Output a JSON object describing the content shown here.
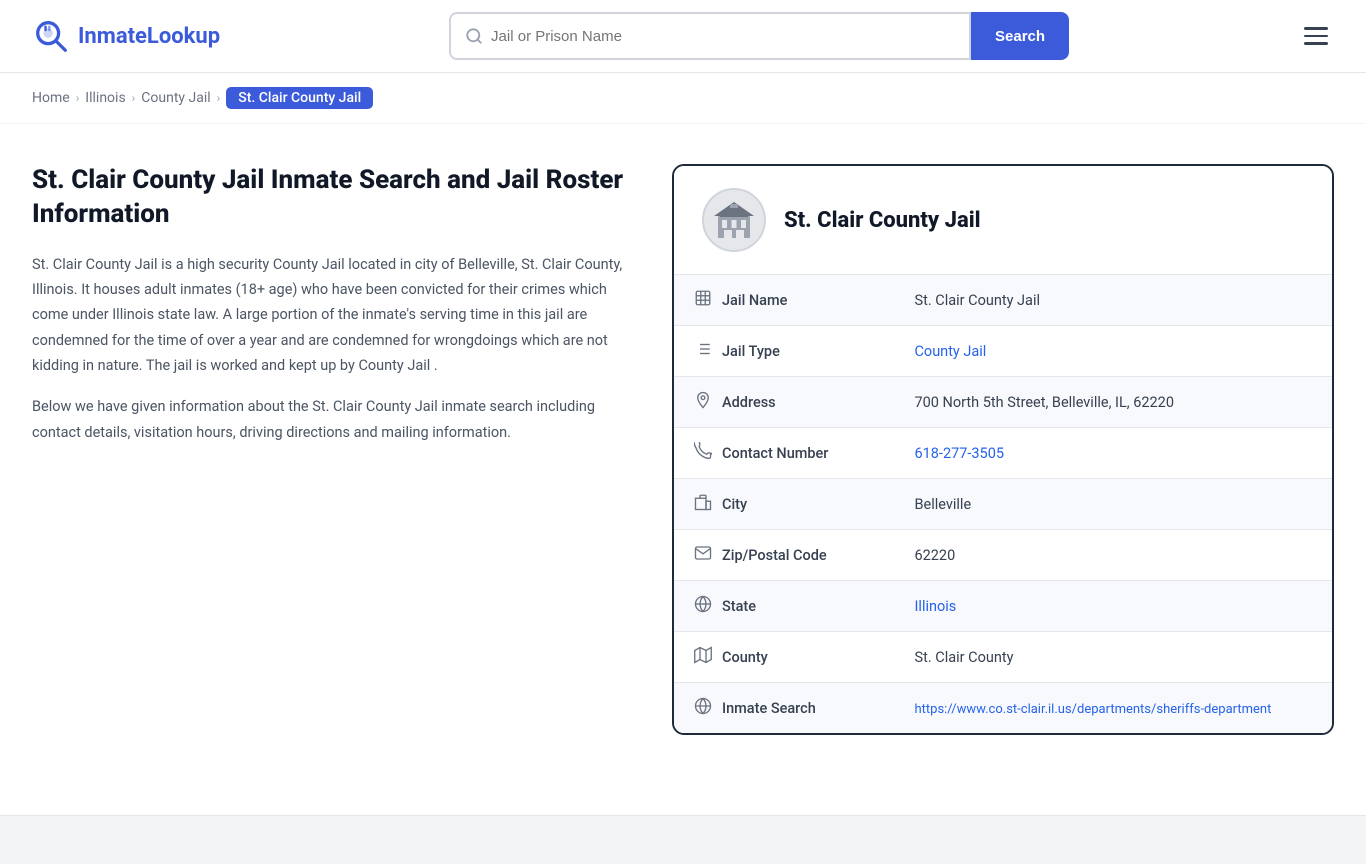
{
  "site": {
    "name": "InmateLookup",
    "name_part1": "Inmate",
    "name_part2": "Lookup"
  },
  "header": {
    "search_placeholder": "Jail or Prison Name",
    "search_button": "Search",
    "hamburger_label": "Menu"
  },
  "breadcrumb": {
    "home": "Home",
    "illinois": "Illinois",
    "county_jail": "County Jail",
    "current": "St. Clair County Jail"
  },
  "left": {
    "heading": "St. Clair County Jail Inmate Search and Jail Roster Information",
    "paragraph1": "St. Clair County Jail is a high security County Jail located in city of Belleville, St. Clair County, Illinois. It houses adult inmates (18+ age) who have been convicted for their crimes which come under Illinois state law. A large portion of the inmate's serving time in this jail are condemned for the time of over a year and are condemned for wrongdoings which are not kidding in nature. The jail is worked and kept up by County Jail .",
    "paragraph2": "Below we have given information about the St. Clair County Jail inmate search including contact details, visitation hours, driving directions and mailing information."
  },
  "card": {
    "title": "St. Clair County Jail",
    "rows": [
      {
        "label": "Jail Name",
        "value": "St. Clair County Jail",
        "link": false,
        "icon": "jail-icon"
      },
      {
        "label": "Jail Type",
        "value": "County Jail",
        "link": true,
        "icon": "list-icon"
      },
      {
        "label": "Address",
        "value": "700 North 5th Street, Belleville, IL, 62220",
        "link": false,
        "icon": "location-icon"
      },
      {
        "label": "Contact Number",
        "value": "618-277-3505",
        "link": true,
        "icon": "phone-icon"
      },
      {
        "label": "City",
        "value": "Belleville",
        "link": false,
        "icon": "city-icon"
      },
      {
        "label": "Zip/Postal Code",
        "value": "62220",
        "link": false,
        "icon": "mail-icon"
      },
      {
        "label": "State",
        "value": "Illinois",
        "link": true,
        "icon": "globe-icon"
      },
      {
        "label": "County",
        "value": "St. Clair County",
        "link": false,
        "icon": "county-icon"
      },
      {
        "label": "Inmate Search",
        "value": "https://www.co.st-clair.il.us/departments/sheriffs-department",
        "link": true,
        "icon": "web-icon"
      }
    ]
  }
}
